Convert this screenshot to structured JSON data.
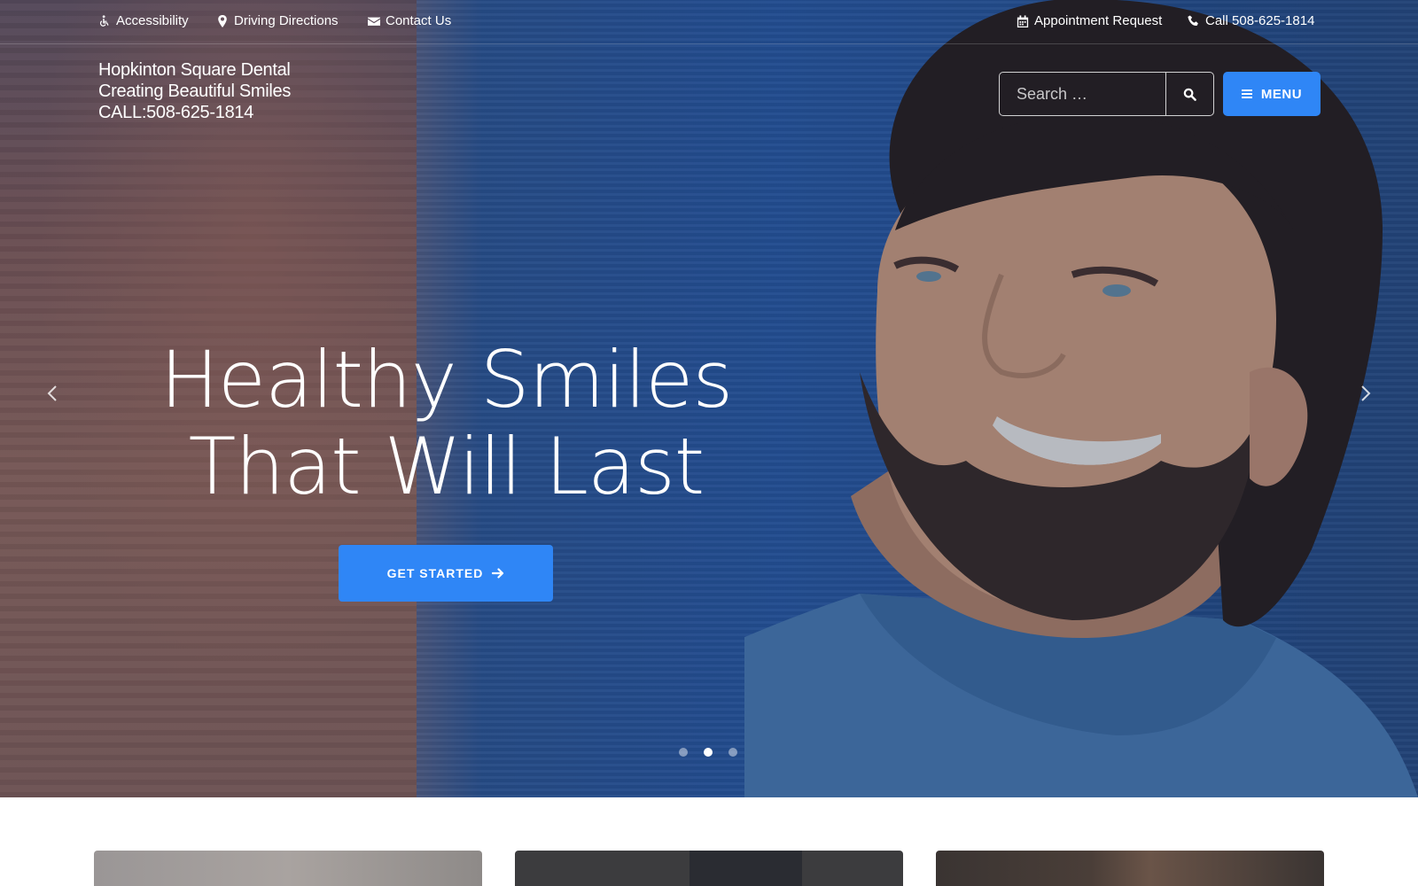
{
  "topbar": {
    "accessibility": "Accessibility",
    "directions": "Driving Directions",
    "contact": "Contact Us",
    "appointment": "Appointment Request",
    "call": "Call 508-625-1814"
  },
  "brand": {
    "line1": "Hopkinton Square Dental",
    "line2": "Creating Beautiful Smiles",
    "line3": "CALL:508-625-1814"
  },
  "search": {
    "placeholder": "Search …"
  },
  "menu": {
    "label": "MENU"
  },
  "hero": {
    "line1": "Healthy Smiles",
    "line2": "That Will Last",
    "cta_label": "GET STARTED",
    "slide_count": 3,
    "active_slide": 2
  },
  "colors": {
    "accent": "#2f86f6",
    "hero_blue": "#2a5ca8"
  },
  "icons": [
    "wheelchair-icon",
    "map-marker-icon",
    "envelope-icon",
    "calendar-icon",
    "phone-icon",
    "search-icon",
    "hamburger-icon",
    "arrow-right-icon",
    "chevron-left-icon",
    "chevron-right-icon"
  ]
}
